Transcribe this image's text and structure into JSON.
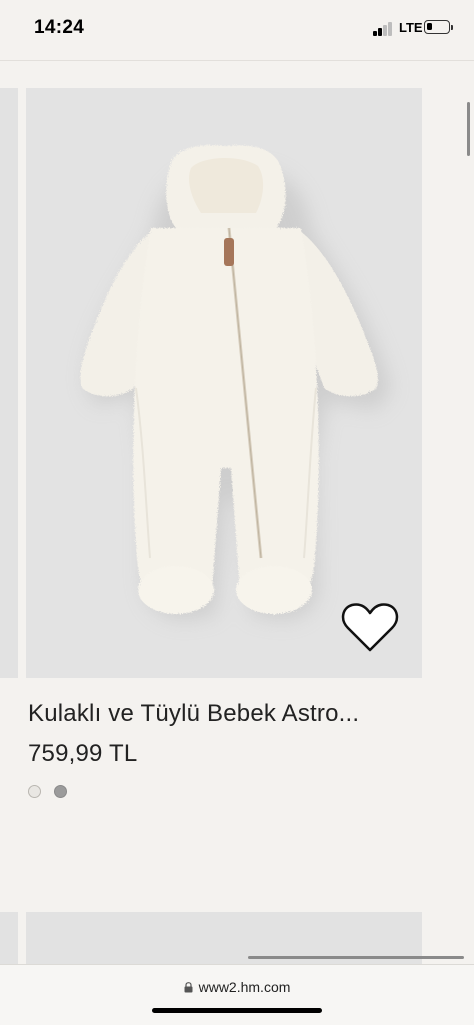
{
  "status_bar": {
    "time": "14:24",
    "network": "LTE",
    "battery_level": 0.2
  },
  "product": {
    "title": "Kulaklı ve Tüylü Bebek Astro...",
    "price": "759,99 TL",
    "image_icon": "teddy-romper-image",
    "wishlist_icon": "heart-outline-icon",
    "color_swatches": [
      {
        "name": "swatch-white",
        "color": "#e9e7e3"
      },
      {
        "name": "swatch-grey",
        "color": "#9b9b9b"
      }
    ]
  },
  "browser": {
    "url": "www2.hm.com",
    "lock_icon": "lock-icon"
  }
}
